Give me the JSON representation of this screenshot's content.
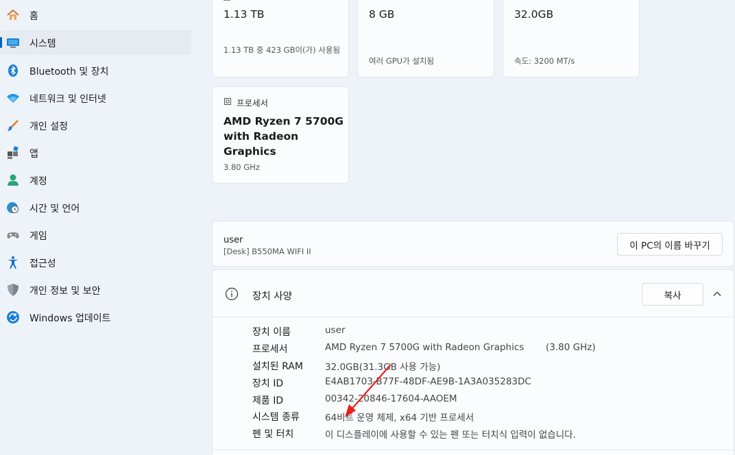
{
  "sidebar": {
    "items": [
      {
        "label": "홈",
        "icon": "home-icon"
      },
      {
        "label": "시스템",
        "icon": "system-icon",
        "active": true
      },
      {
        "label": "Bluetooth 및 장치",
        "icon": "bluetooth-icon"
      },
      {
        "label": "네트워크 및 인터넷",
        "icon": "wifi-icon"
      },
      {
        "label": "개인 설정",
        "icon": "brush-icon"
      },
      {
        "label": "앱",
        "icon": "apps-icon"
      },
      {
        "label": "계정",
        "icon": "account-icon"
      },
      {
        "label": "시간 및 언어",
        "icon": "globe-clock-icon"
      },
      {
        "label": "게임",
        "icon": "gamepad-icon"
      },
      {
        "label": "접근성",
        "icon": "accessibility-icon"
      },
      {
        "label": "개인 정보 및 보안",
        "icon": "shield-icon"
      },
      {
        "label": "Windows 업데이트",
        "icon": "update-icon"
      }
    ],
    "accent_color": "#005fb8"
  },
  "cards": {
    "storage": {
      "value": "1.13 TB",
      "sub": "1.13 TB 중 423 GB이(가) 사용됨"
    },
    "graphics": {
      "value": "8 GB",
      "sub": "여러 GPU가 설치됨"
    },
    "ram": {
      "value": "32.0GB",
      "sub": "속도: 3200 MT/s"
    },
    "processor": {
      "head": "프로세서",
      "title": "AMD Ryzen 7 5700G with Radeon Graphics",
      "sub": "3.80 GHz"
    }
  },
  "device": {
    "name": "user",
    "model": "[Desk] B550MA WIFI II",
    "rename_label": "이 PC의 이름 바꾸기"
  },
  "specs": {
    "title": "장치 사양",
    "copy_label": "복사",
    "rows": [
      {
        "label": "장치 이름",
        "value": "user"
      },
      {
        "label": "프로세서",
        "value": "AMD Ryzen 7 5700G with Radeon Graphics",
        "extra": "(3.80 GHz)"
      },
      {
        "label": "설치된 RAM",
        "value": "32.0GB(31.3GB 사용 가능)"
      },
      {
        "label": "장치 ID",
        "value": "E4AB1703-B77F-48DF-AE9B-1A3A035283DC"
      },
      {
        "label": "제품 ID",
        "value": "00342-20846-17604-AAOEM"
      },
      {
        "label": "시스템 종류",
        "value": "64비트 운영 체제, x64 기반 프로세서"
      },
      {
        "label": "펜 및 터치",
        "value": "이 디스플레이에 사용할 수 있는 펜 또는 터치식 입력이 없습니다."
      }
    ]
  }
}
